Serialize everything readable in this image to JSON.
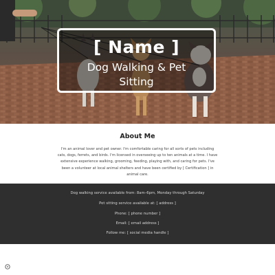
{
  "hero": {
    "name": "[ Name ]",
    "tagline": "Dog Walking & Pet Sitting"
  },
  "about": {
    "title": "About Me",
    "body": "I'm an animal lover and pet owner. I'm comfortable caring for all sorts of pets including cats, dogs, ferrets, and birds. I'm licensed in overseeing up to ten animals at a time. I have extensive experience walking, grooming, feeding, playing with, and caring for pets. I've been a volunteer at local animal shelters and have been certified by [ Certification ] in animal care."
  },
  "contact": {
    "walking_hours": "Dog walking service available from: 8am–6pm, Monday through Saturday",
    "sitting_location": "Pet sitting service available at: [ address ]",
    "phone": "Phone: [ phone number ]",
    "email": "Email: [ email address ]",
    "social": "Follow me: [ social media handle ]"
  },
  "colors": {
    "footer_bg": "#2f2f2f",
    "hero_overlay": "rgba(0,0,0,0.42)",
    "accent_text": "#ffffff"
  },
  "icons": {
    "corner": "info-icon"
  }
}
